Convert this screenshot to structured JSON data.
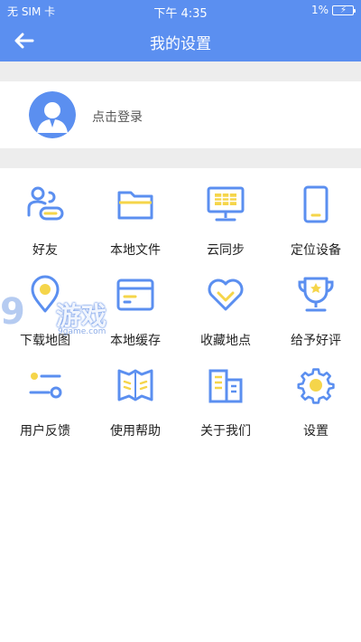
{
  "status_bar": {
    "carrier": "无 SIM 卡",
    "time": "下午 4:35",
    "battery_percent": "1%",
    "battery_icon": "battery-charging-icon"
  },
  "nav": {
    "title": "我的设置",
    "back_icon": "arrow-left-icon"
  },
  "login": {
    "label": "点击登录",
    "avatar_icon": "user-avatar-icon"
  },
  "menu": {
    "items": [
      {
        "label": "好友",
        "icon": "friends-icon"
      },
      {
        "label": "本地文件",
        "icon": "folder-icon"
      },
      {
        "label": "云同步",
        "icon": "cloud-sync-monitor-icon"
      },
      {
        "label": "定位设备",
        "icon": "phone-device-icon"
      },
      {
        "label": "下载地图",
        "icon": "download-map-pin-icon"
      },
      {
        "label": "本地缓存",
        "icon": "cache-card-icon"
      },
      {
        "label": "收藏地点",
        "icon": "heart-icon"
      },
      {
        "label": "给予好评",
        "icon": "trophy-icon"
      },
      {
        "label": "用户反馈",
        "icon": "feedback-toggle-icon"
      },
      {
        "label": "使用帮助",
        "icon": "help-book-icon"
      },
      {
        "label": "关于我们",
        "icon": "building-icon"
      },
      {
        "label": "设置",
        "icon": "gear-icon"
      }
    ]
  },
  "watermark": {
    "logo_digits": "9",
    "logo_text": "游戏",
    "url": "9game.com"
  },
  "colors": {
    "primary_blue": "#5b8ff0",
    "icon_blue": "#5b8ff0",
    "icon_yellow": "#f5d54a",
    "band_gray": "#ededed"
  }
}
